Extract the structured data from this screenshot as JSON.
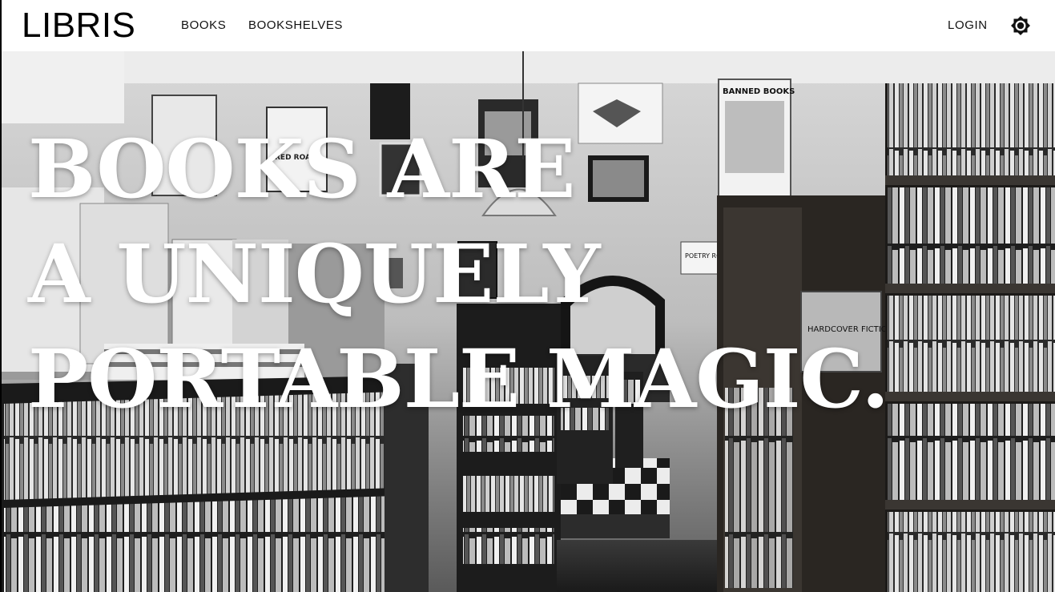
{
  "header": {
    "logo": "LIBRIS",
    "nav": [
      {
        "label": "BOOKS"
      },
      {
        "label": "BOOKSHELVES"
      }
    ],
    "login_label": "LOGIN",
    "theme_icon": "brightness-icon"
  },
  "hero": {
    "headline_lines": [
      "BOOKS ARE",
      "A UNIQUELY",
      "PORTABLE MAGIC."
    ],
    "image": "black-and-white bookstore interior",
    "signs": {
      "banned_books": "BANNED BOOKS",
      "red_roars": "RED ROARS",
      "hardcover": "HARDCOVER FICTION",
      "poetry_room": "POETRY ROOM"
    }
  },
  "colors": {
    "header_bg": "#ffffff",
    "text": "#000000",
    "headline": "#ffffff"
  }
}
